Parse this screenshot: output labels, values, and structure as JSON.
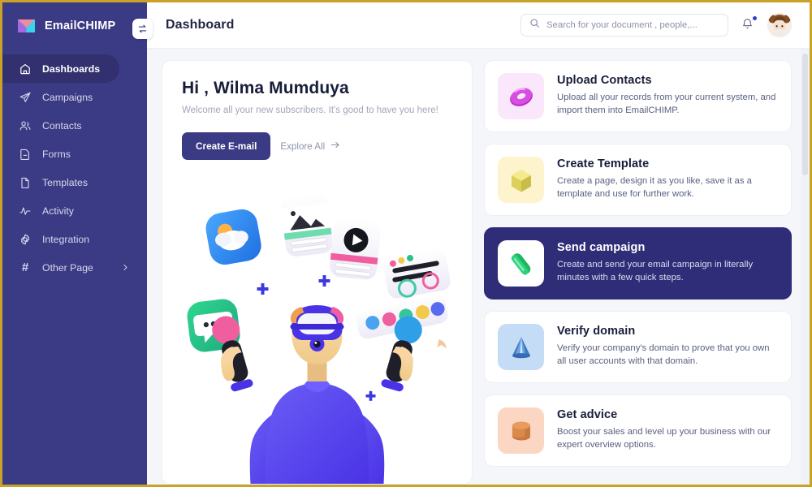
{
  "theme": {
    "sidebar_bg": "#3b3a84",
    "sidebar_active_bg": "#32306f",
    "accent": "#2f2d77",
    "frame_border": "#c9a227",
    "page_bg": "#f5f6fa",
    "card_bg": "#ffffff"
  },
  "sidebar": {
    "brand": {
      "name": "EmailCHIMP",
      "logo_icon": "envelope-logo-icon"
    },
    "toggle": {
      "icon": "swap-arrows-icon"
    },
    "items": [
      {
        "label": "Dashboards",
        "icon": "home-icon",
        "active": true
      },
      {
        "label": "Campaigns",
        "icon": "paper-plane-icon",
        "active": false
      },
      {
        "label": "Contacts",
        "icon": "users-icon",
        "active": false
      },
      {
        "label": "Forms",
        "icon": "form-document-icon",
        "active": false
      },
      {
        "label": "Templates",
        "icon": "file-icon",
        "active": false
      },
      {
        "label": "Activity",
        "icon": "pulse-icon",
        "active": false
      },
      {
        "label": "Integration",
        "icon": "gear-icon",
        "active": false
      },
      {
        "label": "Other Page",
        "icon": "hash-icon",
        "active": false,
        "chevron": "chevron-right-icon"
      }
    ]
  },
  "topbar": {
    "title": "Dashboard",
    "search": {
      "placeholder": "Search for your document , people,...",
      "value": "",
      "icon": "search-icon"
    },
    "notifications": {
      "icon": "bell-icon",
      "has_unread": true
    },
    "avatar": {
      "icon": "avatar",
      "alt": "Wilma Mumduya"
    }
  },
  "hero": {
    "greeting": "Hi , Wilma Mumduya",
    "subtitle": "Welcome all your new subscribers. It's good to have you here!",
    "primary_button": "Create E-mail",
    "secondary_link": "Explore All",
    "secondary_link_icon": "arrow-right-icon",
    "illustration": "vr-man-juggling-app-icons"
  },
  "cards": [
    {
      "title": "Upload Contacts",
      "desc": "Upload all your records from your current system, and import them into EmailCHIMP.",
      "icon": "torus-3d-icon",
      "icon_bg": "#fbe7fb",
      "icon_color": "#d234d2",
      "selected": false
    },
    {
      "title": "Create Template",
      "desc": "Create a page, design it as you like, save it as a template and use for further work.",
      "icon": "cube-3d-icon",
      "icon_bg": "#fdf3cd",
      "icon_color": "#e3d252",
      "selected": false
    },
    {
      "title": "Send campaign",
      "desc": "Create and send your email campaign in literally minutes with a few quick steps.",
      "icon": "capsule-3d-icon",
      "icon_bg": "#ffffff",
      "icon_color": "#24c36a",
      "selected": true
    },
    {
      "title": "Verify domain",
      "desc": "Verify your company's domain to prove that you own all user accounts with that domain.",
      "icon": "cone-3d-icon",
      "icon_bg": "#c5dcf7",
      "icon_color": "#4e87cd",
      "selected": false
    },
    {
      "title": "Get advice",
      "desc": "Boost your sales and level up your business with our expert overview options.",
      "icon": "cylinder-3d-icon",
      "icon_bg": "#fbd6c2",
      "icon_color": "#d8894f",
      "selected": false
    }
  ]
}
